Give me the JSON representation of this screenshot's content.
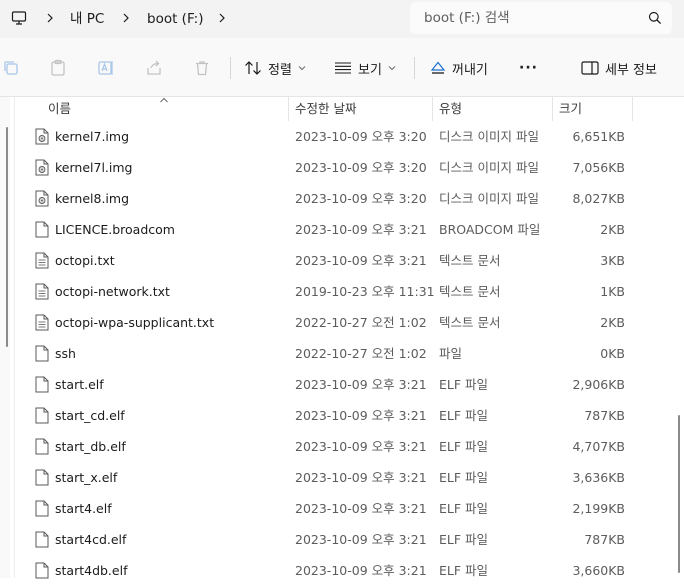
{
  "address": {
    "crumbs": [
      "내 PC",
      "boot (F:)"
    ]
  },
  "search": {
    "placeholder": "boot (F:) 검색"
  },
  "toolbar": {
    "sort_label": "정렬",
    "view_label": "보기",
    "eject_label": "꺼내기",
    "more_label": "···",
    "details_label": "세부 정보"
  },
  "columns": {
    "name": "이름",
    "date": "수정한 날짜",
    "type": "유형",
    "size": "크기"
  },
  "files": [
    {
      "name": "kernel7.img",
      "date": "2023-10-09 오후 3:20",
      "type": "디스크 이미지 파일",
      "size": "6,651KB",
      "icon": "disk-image-icon"
    },
    {
      "name": "kernel7l.img",
      "date": "2023-10-09 오후 3:20",
      "type": "디스크 이미지 파일",
      "size": "7,056KB",
      "icon": "disk-image-icon"
    },
    {
      "name": "kernel8.img",
      "date": "2023-10-09 오후 3:20",
      "type": "디스크 이미지 파일",
      "size": "8,027KB",
      "icon": "disk-image-icon"
    },
    {
      "name": "LICENCE.broadcom",
      "date": "2023-10-09 오후 3:21",
      "type": "BROADCOM 파일",
      "size": "2KB",
      "icon": "file-icon"
    },
    {
      "name": "octopi.txt",
      "date": "2023-10-09 오후 3:21",
      "type": "텍스트 문서",
      "size": "3KB",
      "icon": "text-file-icon"
    },
    {
      "name": "octopi-network.txt",
      "date": "2019-10-23 오후 11:31",
      "type": "텍스트 문서",
      "size": "1KB",
      "icon": "text-file-icon"
    },
    {
      "name": "octopi-wpa-supplicant.txt",
      "date": "2022-10-27 오전 1:02",
      "type": "텍스트 문서",
      "size": "2KB",
      "icon": "text-file-icon"
    },
    {
      "name": "ssh",
      "date": "2022-10-27 오전 1:02",
      "type": "파일",
      "size": "0KB",
      "icon": "file-icon"
    },
    {
      "name": "start.elf",
      "date": "2023-10-09 오후 3:21",
      "type": "ELF 파일",
      "size": "2,906KB",
      "icon": "file-icon"
    },
    {
      "name": "start_cd.elf",
      "date": "2023-10-09 오후 3:21",
      "type": "ELF 파일",
      "size": "787KB",
      "icon": "file-icon"
    },
    {
      "name": "start_db.elf",
      "date": "2023-10-09 오후 3:21",
      "type": "ELF 파일",
      "size": "4,707KB",
      "icon": "file-icon"
    },
    {
      "name": "start_x.elf",
      "date": "2023-10-09 오후 3:21",
      "type": "ELF 파일",
      "size": "3,636KB",
      "icon": "file-icon"
    },
    {
      "name": "start4.elf",
      "date": "2023-10-09 오후 3:21",
      "type": "ELF 파일",
      "size": "2,199KB",
      "icon": "file-icon"
    },
    {
      "name": "start4cd.elf",
      "date": "2023-10-09 오후 3:21",
      "type": "ELF 파일",
      "size": "787KB",
      "icon": "file-icon"
    },
    {
      "name": "start4db.elf",
      "date": "2023-10-09 오후 3:21",
      "type": "ELF 파일",
      "size": "3,660KB",
      "icon": "file-icon"
    }
  ]
}
